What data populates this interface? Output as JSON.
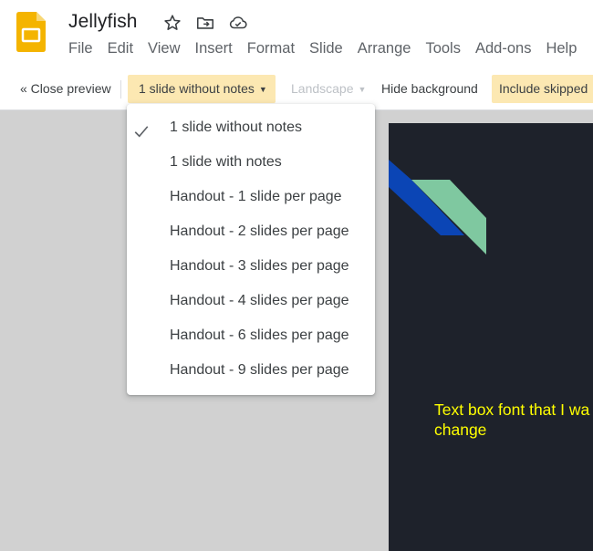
{
  "app": {
    "doc_title": "Jellyfish",
    "menus": [
      "File",
      "Edit",
      "View",
      "Insert",
      "Format",
      "Slide",
      "Arrange",
      "Tools",
      "Add-ons",
      "Help"
    ],
    "title_icons": [
      "star-icon",
      "move-to-folder-icon",
      "cloud-saved-icon"
    ]
  },
  "toolbar": {
    "close_preview": "« Close preview",
    "layout_selected": "1 slide without notes",
    "orientation": "Landscape",
    "hide_background": "Hide background",
    "include_skipped": "Include skipped"
  },
  "layout_menu": {
    "items": [
      {
        "label": "1 slide without notes",
        "checked": true
      },
      {
        "label": "1 slide with notes",
        "checked": false
      },
      {
        "label": "Handout - 1 slide per page",
        "checked": false
      },
      {
        "label": "Handout - 2 slides per page",
        "checked": false
      },
      {
        "label": "Handout - 3 slides per page",
        "checked": false
      },
      {
        "label": "Handout - 4 slides per page",
        "checked": false
      },
      {
        "label": "Handout - 6 slides per page",
        "checked": false
      },
      {
        "label": "Handout - 9 slides per page",
        "checked": false
      }
    ]
  },
  "slide": {
    "text": "Text box font that I wa\nchange",
    "colors": {
      "background": "#1e222b",
      "text": "#ffff00",
      "shape_blue": "#0b45b5",
      "shape_green": "#7fc8a0"
    }
  },
  "colors": {
    "accent_highlight": "#fce8b2",
    "canvas": "#d1d1d1",
    "logo": "#f4b400"
  }
}
